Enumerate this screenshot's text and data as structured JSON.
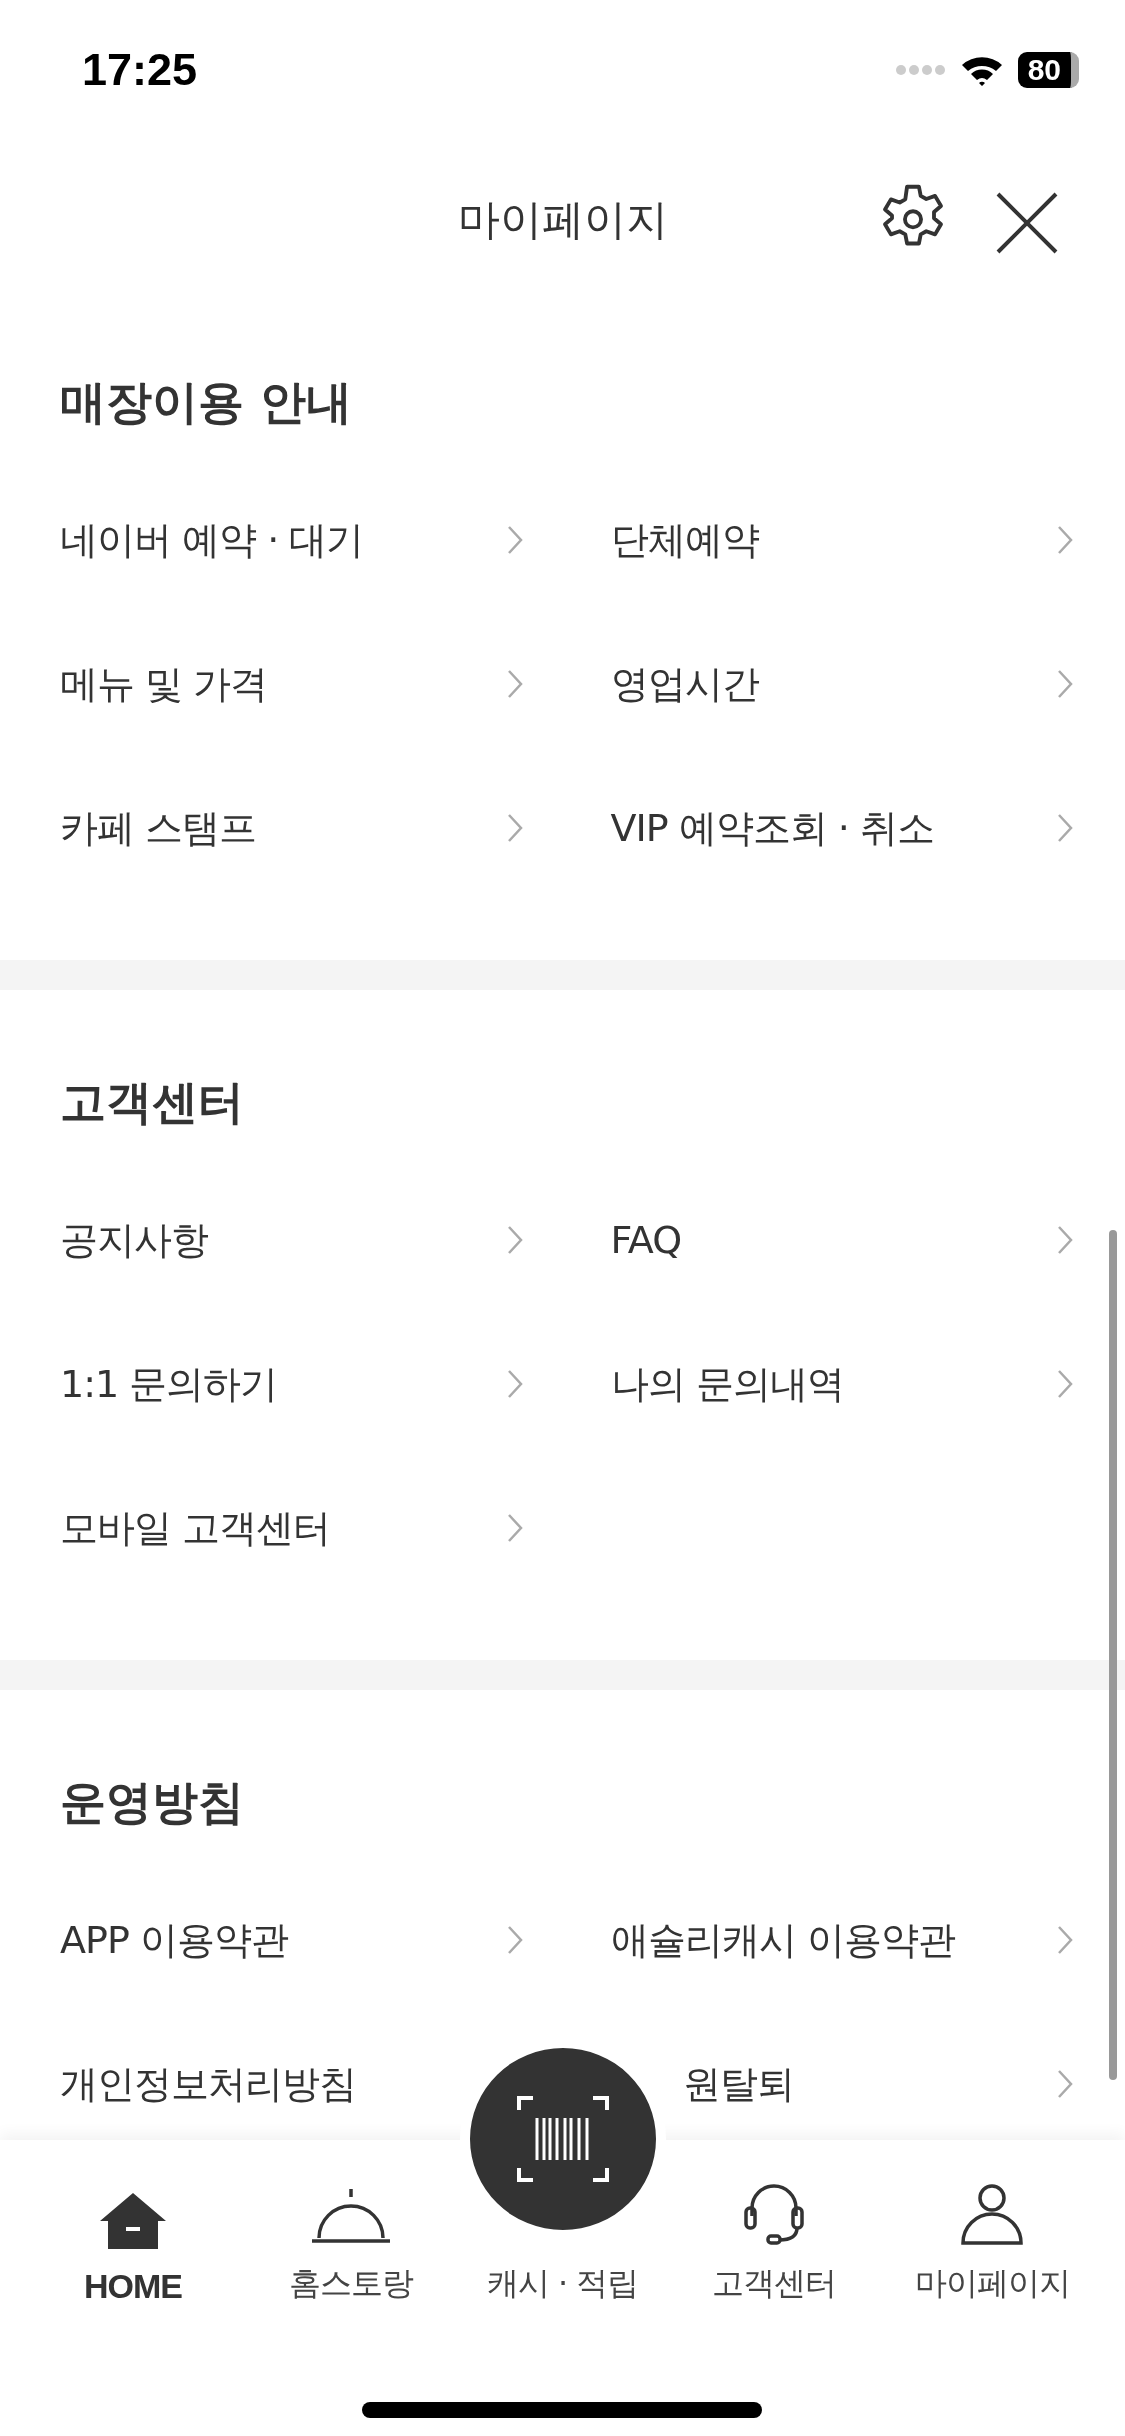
{
  "status_bar": {
    "time": "17:25",
    "battery": "80"
  },
  "header": {
    "title": "마이페이지"
  },
  "sections": [
    {
      "title": "매장이용 안내",
      "items": [
        {
          "label": "네이버 예약 · 대기"
        },
        {
          "label": "단체예약"
        },
        {
          "label": "메뉴 및 가격"
        },
        {
          "label": "영업시간"
        },
        {
          "label": "카페 스탬프"
        },
        {
          "label": "VIP 예약조회 · 취소"
        }
      ]
    },
    {
      "title": "고객센터",
      "items": [
        {
          "label": "공지사항"
        },
        {
          "label": "FAQ"
        },
        {
          "label": "1:1 문의하기"
        },
        {
          "label": "나의 문의내역"
        },
        {
          "label": "모바일 고객센터"
        }
      ]
    },
    {
      "title": "운영방침",
      "items": [
        {
          "label": "APP 이용약관"
        },
        {
          "label": "애슐리캐시 이용약관"
        },
        {
          "label": "개인정보처리방침"
        },
        {
          "label": "원탈퇴"
        }
      ]
    }
  ],
  "bottom_nav": [
    {
      "label": "HOME",
      "selected": true
    },
    {
      "label": "홈스토랑",
      "selected": false
    },
    {
      "label": "캐시 · 적립",
      "selected": false
    },
    {
      "label": "고객센터",
      "selected": false
    },
    {
      "label": "마이페이지",
      "selected": false
    }
  ]
}
